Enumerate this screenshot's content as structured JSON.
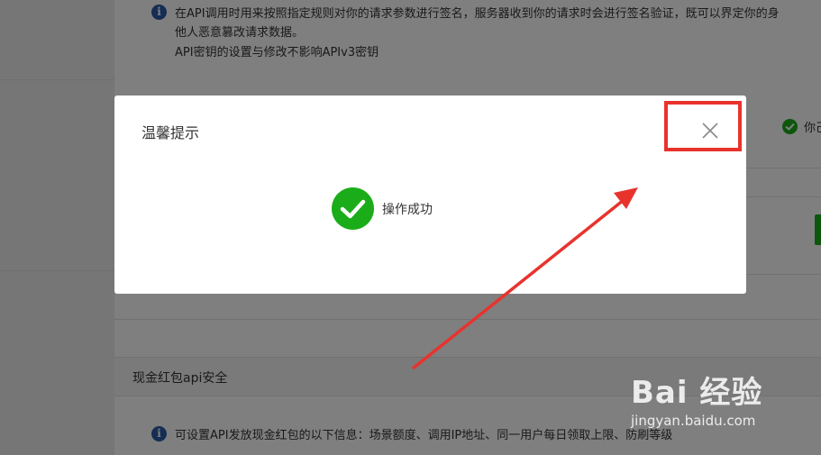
{
  "background": {
    "notice": {
      "line1": "在API调用时用来按照指定规则对你的请求参数进行签名，服务器收到你的请求时会进行签名验证，既可以界定你的身",
      "line2": "他人恶意篡改请求数据。",
      "line3": "API密钥的设置与修改不影响APIv3密钥"
    },
    "right_status_text": "你己",
    "section_title": "现金红包api安全",
    "section_notice": "可设置API发放现金红包的以下信息：场景额度、调用IP地址、同一用户每日领取上限、防刷等级"
  },
  "dialog": {
    "title": "温馨提示",
    "message": "操作成功",
    "close_icon": "close-icon",
    "success_icon": "check-circle-icon"
  },
  "annotation": {
    "highlight_color": "#e8332d",
    "arrow_color": "#e8332d"
  },
  "watermark": {
    "brand": "Bai 经验",
    "url": "jingyan.baidu.com"
  },
  "colors": {
    "success_green": "#1aad19",
    "info_blue": "#2b5aa6"
  }
}
